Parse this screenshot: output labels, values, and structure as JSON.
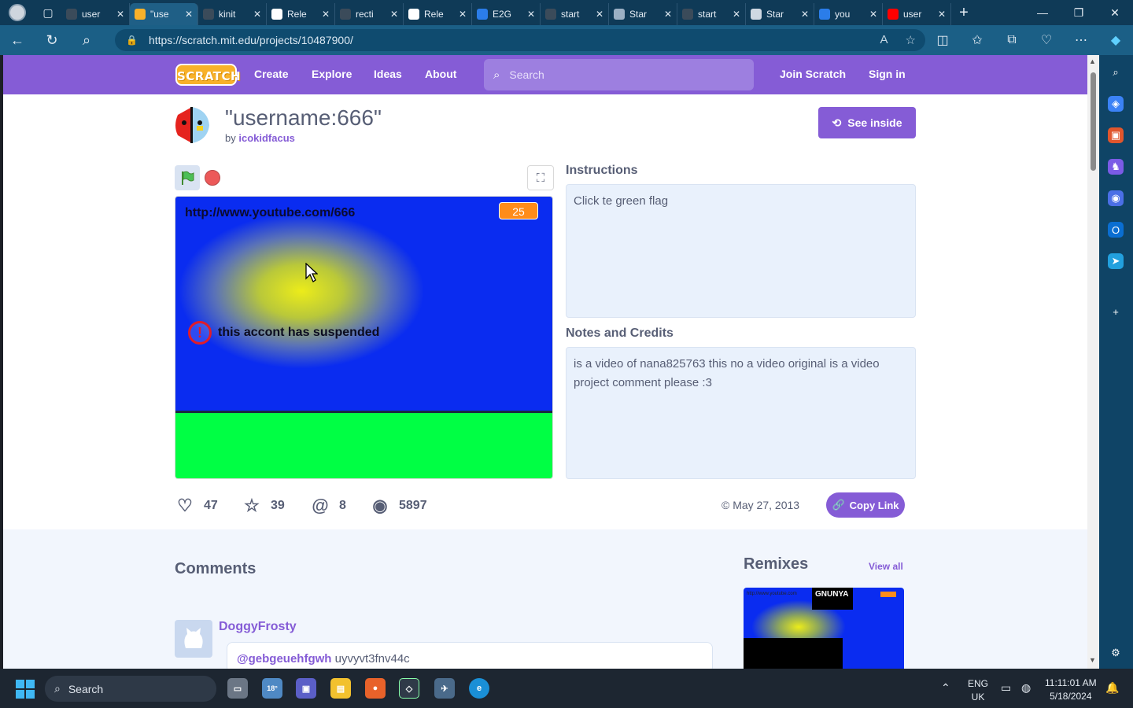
{
  "browser": {
    "tabs": [
      {
        "label": "user",
        "fav_color": "#3b4b5a"
      },
      {
        "label": "\"use",
        "fav_color": "#f8b12a",
        "active": true
      },
      {
        "label": "kinit",
        "fav_color": "#3b4b5a"
      },
      {
        "label": "Rele",
        "fav_color": "#ffffff"
      },
      {
        "label": "recti",
        "fav_color": "#3b4b5a"
      },
      {
        "label": "Rele",
        "fav_color": "#ffffff"
      },
      {
        "label": "E2G",
        "fav_color": "#2b7de9"
      },
      {
        "label": "start",
        "fav_color": "#3b4b5a"
      },
      {
        "label": "Star",
        "fav_color": "#9bb0c4"
      },
      {
        "label": "start",
        "fav_color": "#3b4b5a"
      },
      {
        "label": "Star",
        "fav_color": "#cfd8e2"
      },
      {
        "label": "you",
        "fav_color": "#2b7de9"
      },
      {
        "label": "user",
        "fav_color": "#ff0000"
      }
    ],
    "url": "https://scratch.mit.edu/projects/10487900/"
  },
  "scratch_nav": {
    "logo": "SCRATCH",
    "links": [
      "Create",
      "Explore",
      "Ideas",
      "About"
    ],
    "search_placeholder": "Search",
    "join": "Join Scratch",
    "signin": "Sign in"
  },
  "project": {
    "title": "\"username:666\"",
    "by_prefix": "by",
    "author": "icokidfacus",
    "see_inside": "See inside",
    "stage": {
      "url_text": "http://www.youtube.com/666",
      "counter": "25",
      "warning_icon": "!",
      "message": "this accont has suspended"
    },
    "instructions_heading": "Instructions",
    "instructions": "Click te green flag",
    "notes_heading": "Notes and Credits",
    "notes": "is a video of nana825763 this no a video original is a video project comment please :3",
    "stats": {
      "loves": "47",
      "favorites": "39",
      "remixes": "8",
      "views": "5897"
    },
    "date": "May 27, 2013",
    "copy_link": "Copy Link"
  },
  "comments": {
    "heading": "Comments",
    "items": [
      {
        "user": "DoggyFrosty",
        "mention": "@gebgeuehfgwh",
        "text": "uyvyvt3fnv44c"
      }
    ]
  },
  "remixes": {
    "heading": "Remixes",
    "view_all": "View all",
    "thumb_tag": "GNUNYA",
    "thumb_text": "http://www.youtube.com"
  },
  "taskbar": {
    "search": "Search",
    "weather": "18°",
    "lang_top": "ENG",
    "lang_bottom": "UK",
    "time": "11:11:01 AM",
    "date": "5/18/2024"
  }
}
